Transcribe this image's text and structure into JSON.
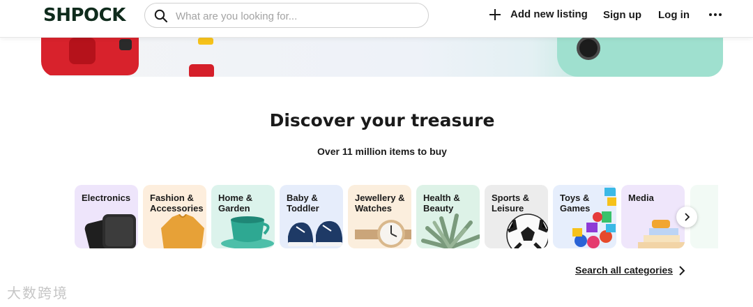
{
  "header": {
    "logo": "SHPOCK",
    "search_placeholder": "What are you looking for...",
    "search_value": "",
    "add_listing": "Add new listing",
    "sign_up": "Sign up",
    "log_in": "Log in"
  },
  "discover": {
    "title": "Discover your treasure",
    "subtitle": "Over 11 million items to buy",
    "categories": [
      {
        "label": "Electronics",
        "bg": "#eee5fb"
      },
      {
        "label": "Fashion & Accessories",
        "bg": "#fdeedd"
      },
      {
        "label": "Home & Garden",
        "bg": "#dcf3ec"
      },
      {
        "label": "Baby & Toddler",
        "bg": "#e6edfb"
      },
      {
        "label": "Jewellery & Watches",
        "bg": "#fbeedd"
      },
      {
        "label": "Health & Beauty",
        "bg": "#ddf2e7"
      },
      {
        "label": "Sports & Leisure",
        "bg": "#ececec"
      },
      {
        "label": "Toys & Games",
        "bg": "#e6eefc"
      },
      {
        "label": "Media",
        "bg": "#efe6fb"
      }
    ],
    "search_all": "Search all categories"
  },
  "watermark": "大数跨境",
  "colors": {
    "brand": "#0f2b1c",
    "hero_mint": "#9fe0cf",
    "toy_red": "#d8222c"
  }
}
